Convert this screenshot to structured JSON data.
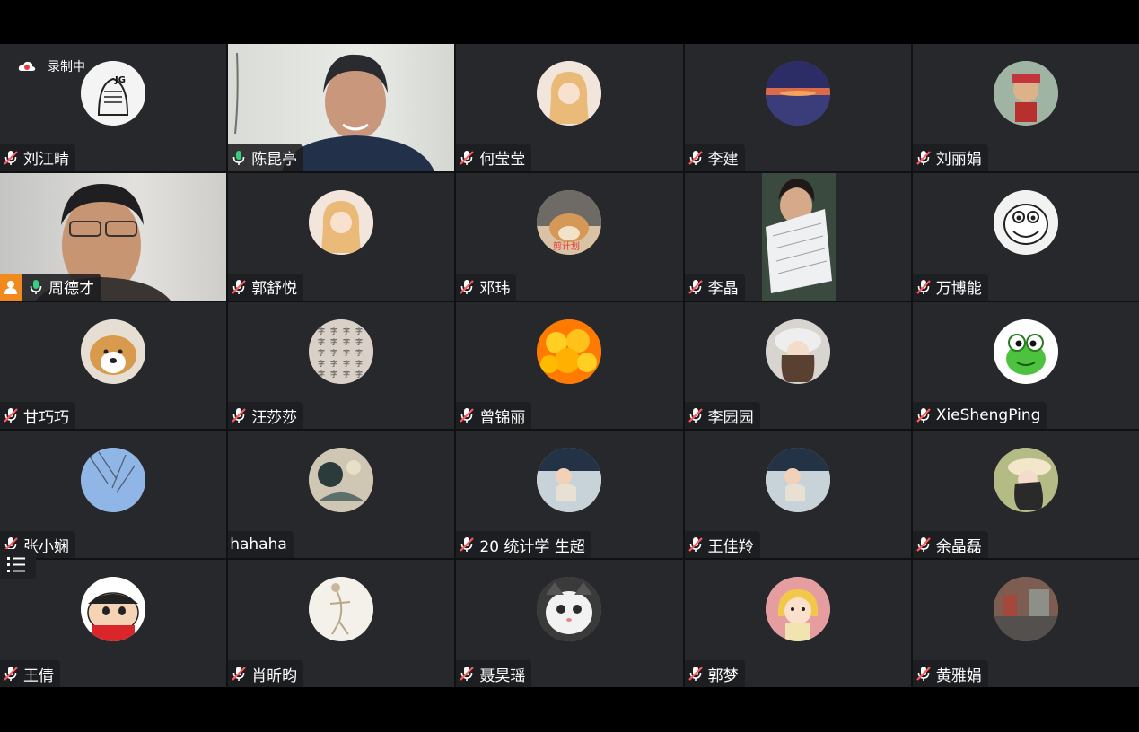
{
  "recording": {
    "label": "录制中"
  },
  "participants": [
    {
      "name": "刘江晴",
      "muted": true,
      "avatar": "avatar-knight-sketch"
    },
    {
      "name": "陈昆亭",
      "muted": false,
      "speaking": true,
      "avatar": "camera-video"
    },
    {
      "name": "何莹莹",
      "muted": true,
      "avatar": "avatar-anime-girl"
    },
    {
      "name": "李建",
      "muted": true,
      "avatar": "avatar-sunset"
    },
    {
      "name": "刘丽娟",
      "muted": true,
      "avatar": "avatar-doll"
    },
    {
      "name": "周德才",
      "muted": false,
      "host": true,
      "avatar": "camera-video"
    },
    {
      "name": "郭舒悦",
      "muted": true,
      "avatar": "avatar-anime-girl"
    },
    {
      "name": "邓玮",
      "muted": true,
      "avatar": "avatar-dog"
    },
    {
      "name": "李晶",
      "muted": true,
      "avatar": "camera-video"
    },
    {
      "name": "万博能",
      "muted": true,
      "avatar": "avatar-cartoon-face"
    },
    {
      "name": "甘巧巧",
      "muted": true,
      "avatar": "avatar-corgi"
    },
    {
      "name": "汪莎莎",
      "muted": true,
      "avatar": "avatar-text-grid"
    },
    {
      "name": "曾锦丽",
      "muted": true,
      "avatar": "avatar-yellow-chicks"
    },
    {
      "name": "李园园",
      "muted": true,
      "avatar": "avatar-girl-hat"
    },
    {
      "name": "XieShengPing",
      "muted": true,
      "avatar": "avatar-frog"
    },
    {
      "name": "张小娴",
      "muted": true,
      "avatar": "avatar-sky-branches"
    },
    {
      "name": "hahaha",
      "muted": false,
      "nomic": true,
      "avatar": "avatar-painting"
    },
    {
      "name": "20 统计学 生超",
      "muted": true,
      "avatar": "avatar-car-girl"
    },
    {
      "name": "王佳羚",
      "muted": true,
      "avatar": "avatar-car-girl"
    },
    {
      "name": "余晶磊",
      "muted": true,
      "avatar": "avatar-girl-sunhat"
    },
    {
      "name": "王倩",
      "muted": true,
      "avatar": "avatar-crayon-shin"
    },
    {
      "name": "肖昕昀",
      "muted": true,
      "avatar": "avatar-sketch-figure"
    },
    {
      "name": "聂昊瑶",
      "muted": true,
      "avatar": "avatar-kitten"
    },
    {
      "name": "郭梦",
      "muted": true,
      "avatar": "avatar-cartoon-girl"
    },
    {
      "name": "黄雅娟",
      "muted": true,
      "avatar": "avatar-street"
    }
  ],
  "colors": {
    "tile": "#26282b",
    "active": "#35d07f",
    "muted": "#ff5a5a",
    "host": "#f08a1c"
  }
}
